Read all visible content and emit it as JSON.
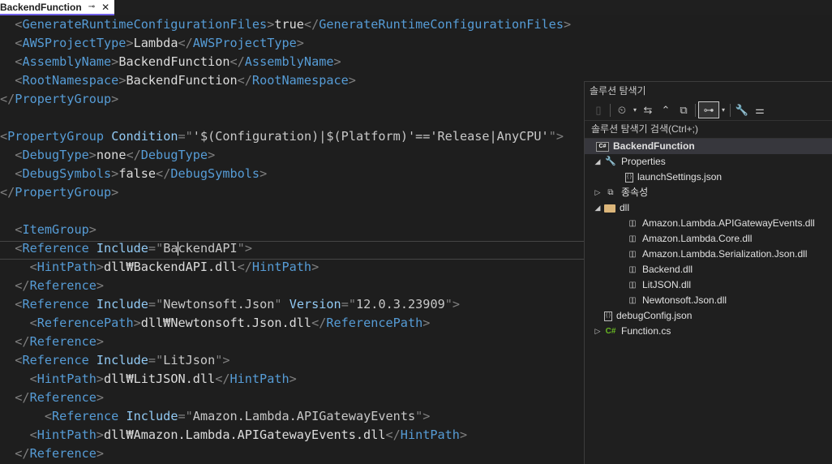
{
  "tab": {
    "title": "BackendFunction",
    "pin_glyph": "⊸",
    "close_glyph": "✕"
  },
  "code": [
    [
      [
        "br",
        "  <"
      ],
      [
        "t",
        "GenerateRuntimeConfigurationFiles"
      ],
      [
        "br",
        ">"
      ],
      [
        "txt",
        "true"
      ],
      [
        "br",
        "</"
      ],
      [
        "t",
        "GenerateRuntimeConfigurationFiles"
      ],
      [
        "br",
        ">"
      ]
    ],
    [
      [
        "br",
        "  <"
      ],
      [
        "t",
        "AWSProjectType"
      ],
      [
        "br",
        ">"
      ],
      [
        "txt",
        "Lambda"
      ],
      [
        "br",
        "</"
      ],
      [
        "t",
        "AWSProjectType"
      ],
      [
        "br",
        ">"
      ]
    ],
    [
      [
        "br",
        "  <"
      ],
      [
        "t",
        "AssemblyName"
      ],
      [
        "br",
        ">"
      ],
      [
        "txt",
        "BackendFunction"
      ],
      [
        "br",
        "</"
      ],
      [
        "t",
        "AssemblyName"
      ],
      [
        "br",
        ">"
      ]
    ],
    [
      [
        "br",
        "  <"
      ],
      [
        "t",
        "RootNamespace"
      ],
      [
        "br",
        ">"
      ],
      [
        "txt",
        "BackendFunction"
      ],
      [
        "br",
        "</"
      ],
      [
        "t",
        "RootNamespace"
      ],
      [
        "br",
        ">"
      ]
    ],
    [
      [
        "br",
        "</"
      ],
      [
        "t",
        "PropertyGroup"
      ],
      [
        "br",
        ">"
      ]
    ],
    [],
    [
      [
        "br",
        "<"
      ],
      [
        "t",
        "PropertyGroup"
      ],
      [
        "txt",
        " "
      ],
      [
        "at",
        "Condition"
      ],
      [
        "br",
        "="
      ],
      [
        "br",
        "\""
      ],
      [
        "av",
        "'$(Configuration)|$(Platform)'=='Release|AnyCPU'"
      ],
      [
        "br",
        "\""
      ],
      [
        "br",
        ">"
      ]
    ],
    [
      [
        "br",
        "  <"
      ],
      [
        "t",
        "DebugType"
      ],
      [
        "br",
        ">"
      ],
      [
        "txt",
        "none"
      ],
      [
        "br",
        "</"
      ],
      [
        "t",
        "DebugType"
      ],
      [
        "br",
        ">"
      ]
    ],
    [
      [
        "br",
        "  <"
      ],
      [
        "t",
        "DebugSymbols"
      ],
      [
        "br",
        ">"
      ],
      [
        "txt",
        "false"
      ],
      [
        "br",
        "</"
      ],
      [
        "t",
        "DebugSymbols"
      ],
      [
        "br",
        ">"
      ]
    ],
    [
      [
        "br",
        "</"
      ],
      [
        "t",
        "PropertyGroup"
      ],
      [
        "br",
        ">"
      ]
    ],
    [],
    [
      [
        "br",
        "  <"
      ],
      [
        "t",
        "ItemGroup"
      ],
      [
        "br",
        ">"
      ]
    ],
    [
      [
        "br",
        "  <"
      ],
      [
        "t",
        "Reference"
      ],
      [
        "txt",
        " "
      ],
      [
        "at",
        "Include"
      ],
      [
        "br",
        "="
      ],
      [
        "br",
        "\""
      ],
      [
        "av",
        "Ba"
      ],
      [
        "caret",
        ""
      ],
      [
        "av",
        "ckendAPI"
      ],
      [
        "br",
        "\""
      ],
      [
        "br",
        ">"
      ]
    ],
    [
      [
        "br",
        "    <"
      ],
      [
        "t",
        "HintPath"
      ],
      [
        "br",
        ">"
      ],
      [
        "txt",
        "dll₩BackendAPI.dll"
      ],
      [
        "br",
        "</"
      ],
      [
        "t",
        "HintPath"
      ],
      [
        "br",
        ">"
      ]
    ],
    [
      [
        "br",
        "  </"
      ],
      [
        "t",
        "Reference"
      ],
      [
        "br",
        ">"
      ]
    ],
    [
      [
        "br",
        "  <"
      ],
      [
        "t",
        "Reference"
      ],
      [
        "txt",
        " "
      ],
      [
        "at",
        "Include"
      ],
      [
        "br",
        "="
      ],
      [
        "br",
        "\""
      ],
      [
        "av",
        "Newtonsoft.Json"
      ],
      [
        "br",
        "\""
      ],
      [
        "txt",
        " "
      ],
      [
        "at",
        "Version"
      ],
      [
        "br",
        "="
      ],
      [
        "br",
        "\""
      ],
      [
        "av",
        "12.0.3.23909"
      ],
      [
        "br",
        "\""
      ],
      [
        "br",
        ">"
      ]
    ],
    [
      [
        "br",
        "    <"
      ],
      [
        "t",
        "ReferencePath"
      ],
      [
        "br",
        ">"
      ],
      [
        "txt",
        "dll₩Newtonsoft.Json.dll"
      ],
      [
        "br",
        "</"
      ],
      [
        "t",
        "ReferencePath"
      ],
      [
        "br",
        ">"
      ]
    ],
    [
      [
        "br",
        "  </"
      ],
      [
        "t",
        "Reference"
      ],
      [
        "br",
        ">"
      ]
    ],
    [
      [
        "br",
        "  <"
      ],
      [
        "t",
        "Reference"
      ],
      [
        "txt",
        " "
      ],
      [
        "at",
        "Include"
      ],
      [
        "br",
        "="
      ],
      [
        "br",
        "\""
      ],
      [
        "av",
        "LitJson"
      ],
      [
        "br",
        "\""
      ],
      [
        "br",
        ">"
      ]
    ],
    [
      [
        "br",
        "    <"
      ],
      [
        "t",
        "HintPath"
      ],
      [
        "br",
        ">"
      ],
      [
        "txt",
        "dll₩LitJSON.dll"
      ],
      [
        "br",
        "</"
      ],
      [
        "t",
        "HintPath"
      ],
      [
        "br",
        ">"
      ]
    ],
    [
      [
        "br",
        "  </"
      ],
      [
        "t",
        "Reference"
      ],
      [
        "br",
        ">"
      ]
    ],
    [
      [
        "br",
        "      <"
      ],
      [
        "t",
        "Reference"
      ],
      [
        "txt",
        " "
      ],
      [
        "at",
        "Include"
      ],
      [
        "br",
        "="
      ],
      [
        "br",
        "\""
      ],
      [
        "av",
        "Amazon.Lambda.APIGatewayEvents"
      ],
      [
        "br",
        "\""
      ],
      [
        "br",
        ">"
      ]
    ],
    [
      [
        "br",
        "    <"
      ],
      [
        "t",
        "HintPath"
      ],
      [
        "br",
        ">"
      ],
      [
        "txt",
        "dll₩Amazon.Lambda.APIGatewayEvents.dll"
      ],
      [
        "br",
        "</"
      ],
      [
        "t",
        "HintPath"
      ],
      [
        "br",
        ">"
      ]
    ],
    [
      [
        "br",
        "  </"
      ],
      [
        "t",
        "Reference"
      ],
      [
        "br",
        ">"
      ]
    ]
  ],
  "solution_explorer": {
    "title": "솔루션 탐색기",
    "search_placeholder": "솔루션 탐색기 검색(Ctrl+;)",
    "toolbar_icons": [
      "switch-view-icon",
      "history-icon",
      "sync-icon",
      "collapse-all-icon",
      "copy-pages-icon",
      "show-all-files-icon",
      "properties-icon",
      "preview-icon"
    ],
    "items": [
      {
        "label": "BackendFunction",
        "icon": "csharp-project-icon",
        "level": 0,
        "expand": "",
        "selected": true,
        "bold": true
      },
      {
        "label": "Properties",
        "icon": "wrench-icon",
        "level": 1,
        "expand": "open"
      },
      {
        "label": "launchSettings.json",
        "icon": "json-file-icon",
        "level": 2,
        "expand": ""
      },
      {
        "label": "종속성",
        "icon": "dependencies-icon",
        "level": 1,
        "expand": "closed"
      },
      {
        "label": "dll",
        "icon": "folder-icon",
        "level": 1,
        "expand": "open"
      },
      {
        "label": "Amazon.Lambda.APIGatewayEvents.dll",
        "icon": "dll-file-icon",
        "level": 2,
        "expand": ""
      },
      {
        "label": "Amazon.Lambda.Core.dll",
        "icon": "dll-file-icon",
        "level": 2,
        "expand": ""
      },
      {
        "label": "Amazon.Lambda.Serialization.Json.dll",
        "icon": "dll-file-icon",
        "level": 2,
        "expand": ""
      },
      {
        "label": "Backend.dll",
        "icon": "dll-file-icon",
        "level": 2,
        "expand": ""
      },
      {
        "label": "LitJSON.dll",
        "icon": "dll-file-icon",
        "level": 2,
        "expand": ""
      },
      {
        "label": "Newtonsoft.Json.dll",
        "icon": "dll-file-icon",
        "level": 2,
        "expand": ""
      },
      {
        "label": "debugConfig.json",
        "icon": "json-file-icon",
        "level": 1,
        "expand": ""
      },
      {
        "label": "Function.cs",
        "icon": "csharp-file-icon",
        "level": 1,
        "expand": "closed"
      }
    ]
  },
  "colors": {
    "tag": "#569cd6",
    "bracket": "#808080",
    "attr": "#92caf4",
    "text": "#dcdcdc",
    "accent": "#7160e8"
  }
}
